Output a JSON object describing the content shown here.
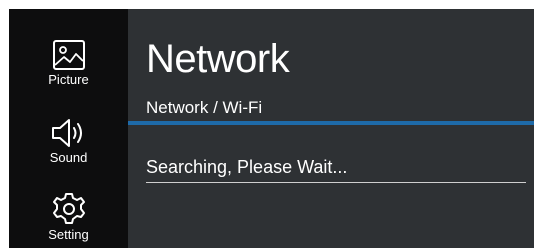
{
  "sidebar": {
    "items": [
      {
        "label": "Picture",
        "icon": "picture-icon"
      },
      {
        "label": "Sound",
        "icon": "speaker-icon"
      },
      {
        "label": "Setting",
        "icon": "gear-icon"
      }
    ]
  },
  "main": {
    "title": "Network",
    "subtitle": "Network / Wi-Fi",
    "status": "Searching, Please Wait..."
  },
  "colors": {
    "background": "#2e3134",
    "sidebar": "#0d0d0e",
    "accent": "#1e6aa8",
    "text": "#ffffff"
  }
}
